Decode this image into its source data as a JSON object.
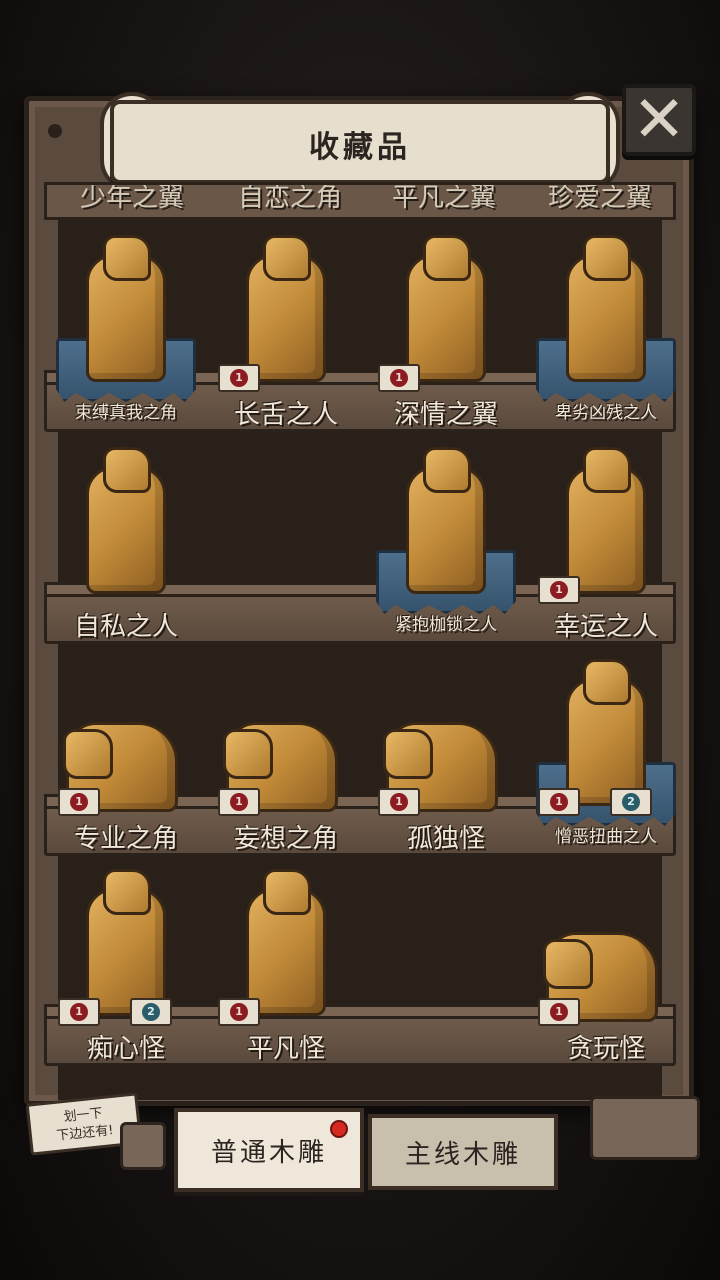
{
  "title": "收藏品",
  "close_icon": "close-icon",
  "top_row": [
    "少年之翼",
    "自恋之角",
    "平凡之翼",
    "珍爱之翼"
  ],
  "rows": [
    [
      {
        "label": "束缚真我之角",
        "plate": true,
        "small": true,
        "tags": []
      },
      {
        "label": "长舌之人",
        "plate": false,
        "small": false,
        "tags": [
          "1"
        ]
      },
      {
        "label": "深情之翼",
        "plate": false,
        "small": false,
        "tags": [
          "1"
        ]
      },
      {
        "label": "卑劣凶残之人",
        "plate": true,
        "small": true,
        "tags": []
      }
    ],
    [
      {
        "label": "自私之人",
        "plate": false,
        "small": false,
        "tags": []
      },
      {
        "label": "",
        "empty": true
      },
      {
        "label": "紧抱枷锁之人",
        "plate": true,
        "small": true,
        "tags": []
      },
      {
        "label": "幸运之人",
        "plate": false,
        "small": false,
        "tags": [
          "1"
        ]
      }
    ],
    [
      {
        "label": "专业之角",
        "plate": false,
        "small": false,
        "tags": [
          "1"
        ]
      },
      {
        "label": "妄想之角",
        "plate": false,
        "small": false,
        "tags": [
          "1"
        ]
      },
      {
        "label": "孤独怪",
        "plate": false,
        "small": false,
        "tags": [
          "1"
        ]
      },
      {
        "label": "憎恶扭曲之人",
        "plate": true,
        "small": true,
        "tags": [
          "1",
          "2"
        ]
      }
    ],
    [
      {
        "label": "痴心怪",
        "plate": false,
        "small": false,
        "tags": [
          "1",
          "2"
        ]
      },
      {
        "label": "平凡怪",
        "plate": false,
        "small": false,
        "tags": [
          "1"
        ]
      },
      {
        "label": "",
        "empty": true
      },
      {
        "label": "贪玩怪",
        "plate": false,
        "small": false,
        "tags": [
          "1"
        ]
      }
    ]
  ],
  "hint": {
    "line1": "划一下",
    "line2": "下边还有!"
  },
  "tabs": {
    "normal": "普通木雕",
    "main": "主线木雕"
  }
}
